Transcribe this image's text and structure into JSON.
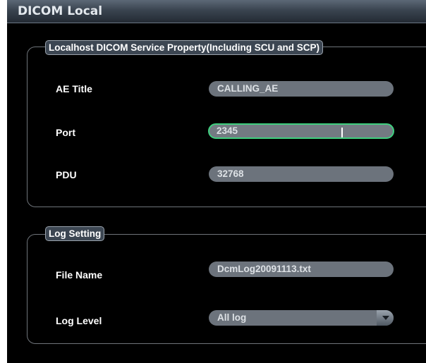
{
  "window": {
    "title": "DICOM Local"
  },
  "service_group": {
    "legend": "Localhost DICOM Service Property(Including SCU and SCP)",
    "ae_title": {
      "label": "AE Title",
      "value": "CALLING_AE"
    },
    "port": {
      "label": "Port",
      "value": "2345"
    },
    "pdu": {
      "label": "PDU",
      "value": "32768"
    }
  },
  "log_group": {
    "legend": "Log Setting",
    "file_name": {
      "label": "File Name",
      "value": "DcmLog20091113.txt"
    },
    "log_level": {
      "label": "Log Level",
      "value": "All log"
    }
  },
  "colors": {
    "background": "#000000",
    "field": "#6c737c",
    "focus_border": "#3fd07f",
    "title_bar": "#3a4450"
  },
  "icons": {
    "dropdown": "chevron-down-icon"
  }
}
